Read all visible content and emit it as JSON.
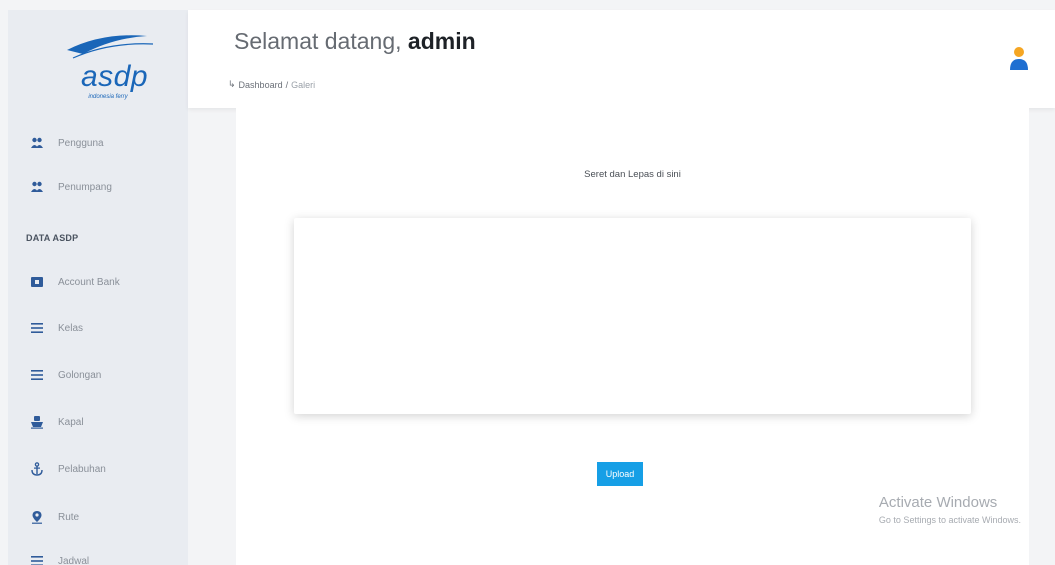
{
  "logo": {
    "text": "asdp",
    "tagline": "indonesia ferry"
  },
  "sidebar": {
    "top_items": [
      {
        "label": "Pengguna",
        "icon": "users-icon"
      },
      {
        "label": "Penumpang",
        "icon": "users-icon"
      }
    ],
    "section_title": "DATA ASDP",
    "items": [
      {
        "label": "Account Bank",
        "icon": "bank-card-icon"
      },
      {
        "label": "Kelas",
        "icon": "list-icon"
      },
      {
        "label": "Golongan",
        "icon": "list-icon"
      },
      {
        "label": "Kapal",
        "icon": "ship-icon"
      },
      {
        "label": "Pelabuhan",
        "icon": "anchor-icon"
      },
      {
        "label": "Rute",
        "icon": "map-pin-icon"
      },
      {
        "label": "Jadwal",
        "icon": "list-icon"
      }
    ]
  },
  "header": {
    "greeting": "Selamat datang,",
    "username": "admin",
    "breadcrumb_arrow": "↳",
    "breadcrumb_root": "Dashboard",
    "breadcrumb_sep": "/",
    "breadcrumb_current": "Galeri"
  },
  "main": {
    "drop_title": "Seret dan Lepas di sini",
    "upload_label": "Upload"
  },
  "watermark": {
    "title": "Activate Windows",
    "subtitle": "Go to Settings to activate Windows."
  },
  "colors": {
    "accent": "#169fe6",
    "sidebar_bg": "#e9ecf1",
    "brand_blue": "#1a66b8"
  }
}
